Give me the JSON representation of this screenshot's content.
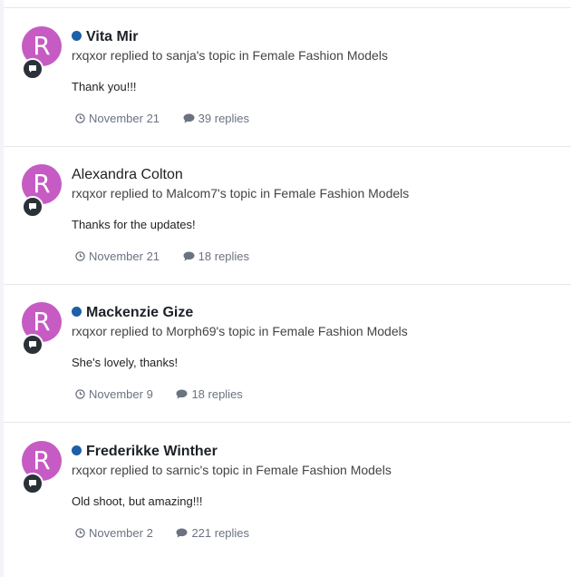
{
  "feed": {
    "items": [
      {
        "avatar_letter": "R",
        "author": "Vita Mir",
        "online": true,
        "activity": "rxqxor replied to sanja's topic in Female Fashion Models",
        "snippet": "Thank you!!!",
        "date": "November 21",
        "replies": "39 replies"
      },
      {
        "avatar_letter": "R",
        "author": "Alexandra Colton",
        "online": false,
        "activity": "rxqxor replied to Malcom7's topic in Female Fashion Models",
        "snippet": "Thanks for the updates!",
        "date": "November 21",
        "replies": "18 replies"
      },
      {
        "avatar_letter": "R",
        "author": "Mackenzie Gize",
        "online": true,
        "activity": "rxqxor replied to Morph69's topic in Female Fashion Models",
        "snippet": "She's lovely, thanks!",
        "date": "November 9",
        "replies": "18 replies"
      },
      {
        "avatar_letter": "R",
        "author": "Frederikke Winther",
        "online": true,
        "activity": "rxqxor replied to sarnic's topic in Female Fashion Models",
        "snippet": "Old shoot, but amazing!!!",
        "date": "November 2",
        "replies": "221 replies"
      }
    ]
  },
  "colors": {
    "avatar": "#c65bc3",
    "online_dot": "#1d5fa8",
    "badge": "#2b3138",
    "meta": "#6b7280"
  }
}
